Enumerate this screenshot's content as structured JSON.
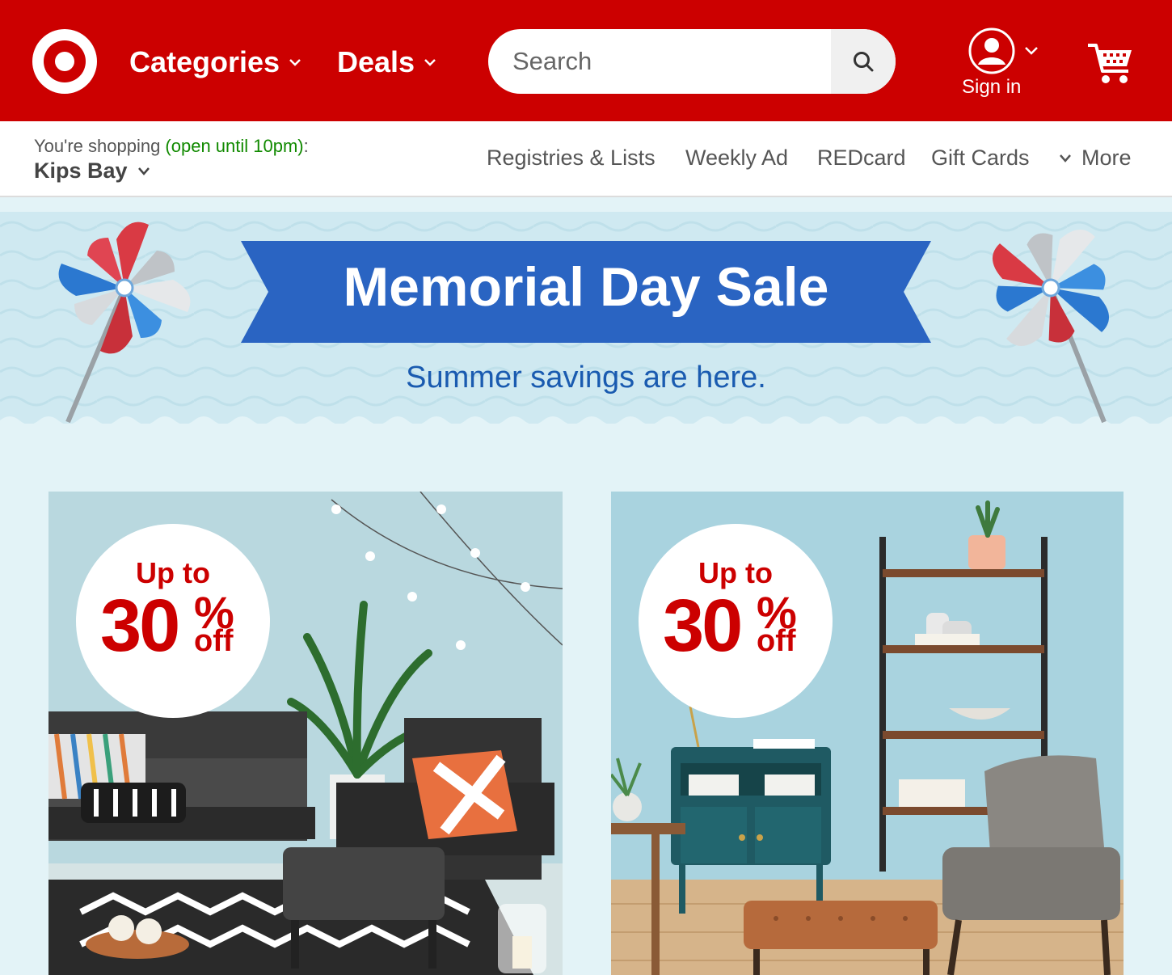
{
  "header": {
    "logo": "Target bullseye logo",
    "categories_label": "Categories",
    "deals_label": "Deals",
    "search_placeholder": "Search",
    "sign_in_label": "Sign in",
    "brand_color": "#cc0000"
  },
  "store": {
    "prefix": "You're shopping ",
    "hours": "(open until 10pm)",
    "suffix": ":",
    "name": "Kips Bay"
  },
  "subnav": {
    "items": [
      "Registries & Lists",
      "Weekly Ad",
      "REDcard",
      "Gift Cards"
    ],
    "more_label": "More"
  },
  "banner": {
    "title": "Memorial Day Sale",
    "subtitle": "Summer savings are here.",
    "ribbon_color": "#2a64c2",
    "subtitle_color": "#1a5bb0"
  },
  "promos": [
    {
      "up_to": "Up to",
      "amount": "30",
      "percent": "%",
      "off": "off",
      "scene": "outdoor patio furniture"
    },
    {
      "up_to": "Up to",
      "amount": "30",
      "percent": "%",
      "off": "off",
      "scene": "living room furniture"
    }
  ],
  "icons": {
    "search": "search-icon",
    "account": "account-icon",
    "cart": "cart-icon",
    "chevron": "chevron-down-icon",
    "pinwheel": "pinwheel-icon"
  }
}
